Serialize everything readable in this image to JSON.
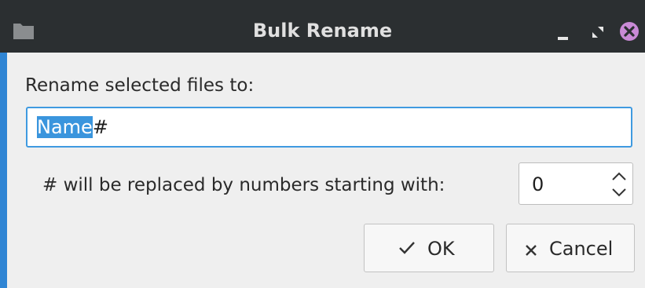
{
  "window": {
    "title": "Bulk Rename",
    "icons": {
      "app": "folder-icon",
      "minimize": "minimize-icon",
      "restore": "restore-icon",
      "close": "close-icon"
    }
  },
  "form": {
    "prompt_label": "Rename selected files to:",
    "name_input": {
      "selected_text": "Name",
      "rest_text": "#"
    },
    "numbering_label": "# will be replaced by numbers starting with:",
    "start_number": "0"
  },
  "buttons": {
    "ok": {
      "label": "OK",
      "icon": "check-icon"
    },
    "cancel": {
      "label": "Cancel",
      "icon": "x-icon"
    }
  },
  "colors": {
    "titlebar": "#2b2f31",
    "accent": "#3a95dd",
    "close_button": "#c98ad6"
  }
}
